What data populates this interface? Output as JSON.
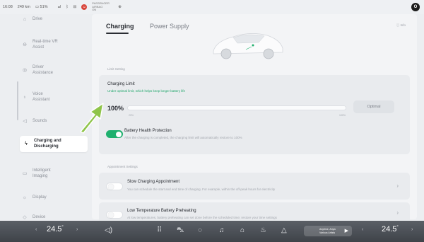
{
  "status": {
    "time": "16:08",
    "range": "249 km",
    "battery": "51%",
    "passenger_airbag": "PASSENGER AIRBAG ON"
  },
  "sidebar": {
    "items": [
      {
        "label": "Drive",
        "icon": "drive-icon"
      },
      {
        "label": "Real-time VR Assist",
        "icon": "vr-assist-icon"
      },
      {
        "label": "Driver Assistance",
        "icon": "driver-assist-icon"
      },
      {
        "label": "Voice Assistant",
        "icon": "voice-icon"
      },
      {
        "label": "Sounds",
        "icon": "speaker-icon"
      },
      {
        "label": "Charging and Discharging",
        "icon": "charging-icon",
        "active": true
      },
      {
        "label": "Intelligent Imaging",
        "icon": "imaging-icon"
      },
      {
        "label": "Display",
        "icon": "display-icon"
      },
      {
        "label": "Device",
        "icon": "device-icon"
      }
    ]
  },
  "main": {
    "tabs": [
      {
        "label": "Charging",
        "active": true
      },
      {
        "label": "Power Supply",
        "active": false
      }
    ],
    "info": "ⓘ Info",
    "limit_section": "Limit Setting",
    "charging_limit": {
      "title": "Charging Limit",
      "subtitle": "Under optimal limit, which helps keep longer battery life",
      "value": "100%",
      "value_fraction": 1.0,
      "tick_min": "20%",
      "tick_max": "100%",
      "optimal_label": "Optimal"
    },
    "battery_health": {
      "title": "Battery Health Protection",
      "subtitle": "After the charging is completed, the charging limit will automatically restore to 100%",
      "on": true
    },
    "appointment_section": "Appointment Settings",
    "slow_charging": {
      "title": "Slow Charging Appointment",
      "subtitle": "You can schedule the start and end time of charging. For example, within the off-peak hours for electricity",
      "on": false
    },
    "low_temp": {
      "title": "Low Temperature Battery Preheating",
      "subtitle": "At low temperatures, battery preheating can set done before the scheduled time; restore your time settings",
      "on": false
    }
  },
  "dock": {
    "left_temp": "24.5",
    "right_temp": "24.5",
    "degree": "°",
    "media_title": "Anytime, Anyw",
    "media_sub": "Various Artists",
    "colors": {
      "accent": "#1fb06e",
      "arrow": "#8fc44a",
      "dock": "#4a4e55"
    }
  }
}
